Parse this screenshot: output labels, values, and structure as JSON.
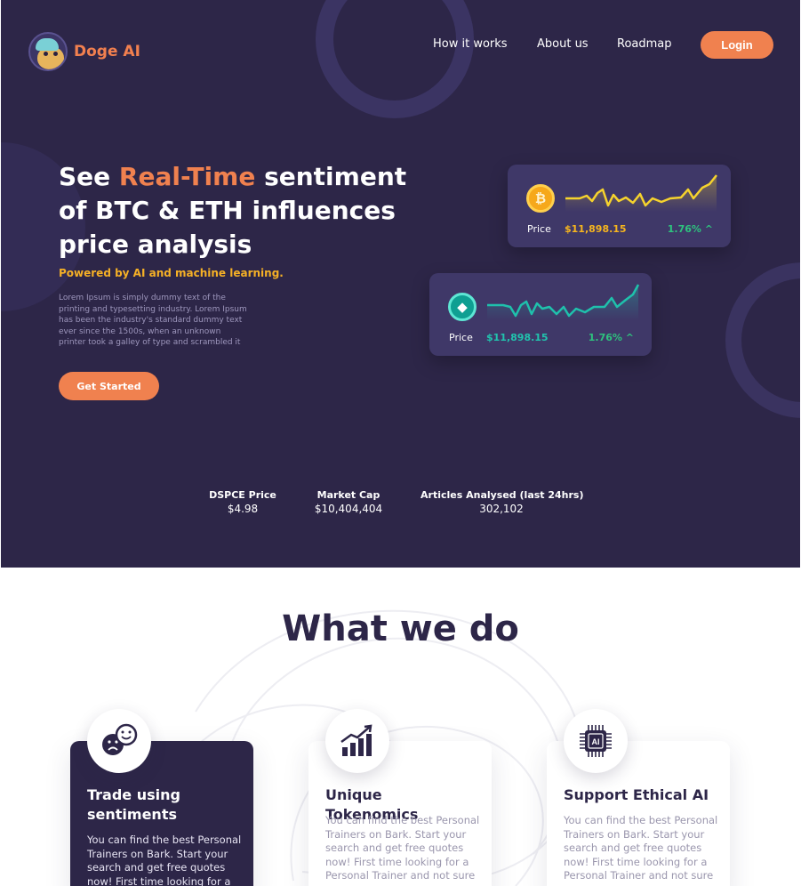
{
  "brand": {
    "name": "Doge AI"
  },
  "nav": {
    "items": [
      {
        "label": "How it works"
      },
      {
        "label": "About us"
      },
      {
        "label": "Roadmap"
      }
    ],
    "login_label": "Login"
  },
  "hero": {
    "headline_pre": "See ",
    "headline_accent": "Real-Time",
    "headline_post": " sentiment of BTC & ETH influences price analysis",
    "subline": "Powered by AI and machine learning.",
    "description": "Lorem Ipsum is simply dummy text of the printing and typesetting industry. Lorem Ipsum has been the industry's standard dummy text ever since the 1500s, when an unknown printer took a galley of type and scrambled it",
    "cta_label": "Get Started"
  },
  "cards": {
    "btc": {
      "price_label": "Price",
      "price_value": "$11,898.15",
      "change": "1.76% ^",
      "line_color": "#f6d32d"
    },
    "eth": {
      "price_label": "Price",
      "price_value": "$11,898.15",
      "change": "1.76% ^",
      "line_color": "#1fc1ac"
    }
  },
  "stats": [
    {
      "label": "DSPCE Price",
      "value": "$4.98"
    },
    {
      "label": "Market Cap",
      "value": "$10,404,404"
    },
    {
      "label": "Articles Analysed (last 24hrs)",
      "value": "302,102"
    }
  ],
  "what_we_do": {
    "title": "What we do",
    "features": [
      {
        "title": "Trade using sentiments",
        "body": "You can find the best Personal Trainers on Bark. Start your search and get free quotes now! First time looking for a",
        "icon": "sentiment-faces-icon"
      },
      {
        "title": "Unique Tokenomics",
        "body": "You can find the best Personal Trainers on Bark. Start your search and get free quotes now! First time looking for a Personal Trainer and not sure",
        "icon": "growth-chart-icon"
      },
      {
        "title": "Support Ethical AI",
        "body": "You can find the best Personal Trainers on Bark. Start your search and get free quotes now! First time looking for a Personal Trainer and not sure",
        "icon": "ai-chip-icon"
      }
    ]
  },
  "colors": {
    "hero_bg": "#2d2648",
    "accent": "#f0814f",
    "highlight": "#f5b026",
    "positive": "#2ec27e"
  }
}
